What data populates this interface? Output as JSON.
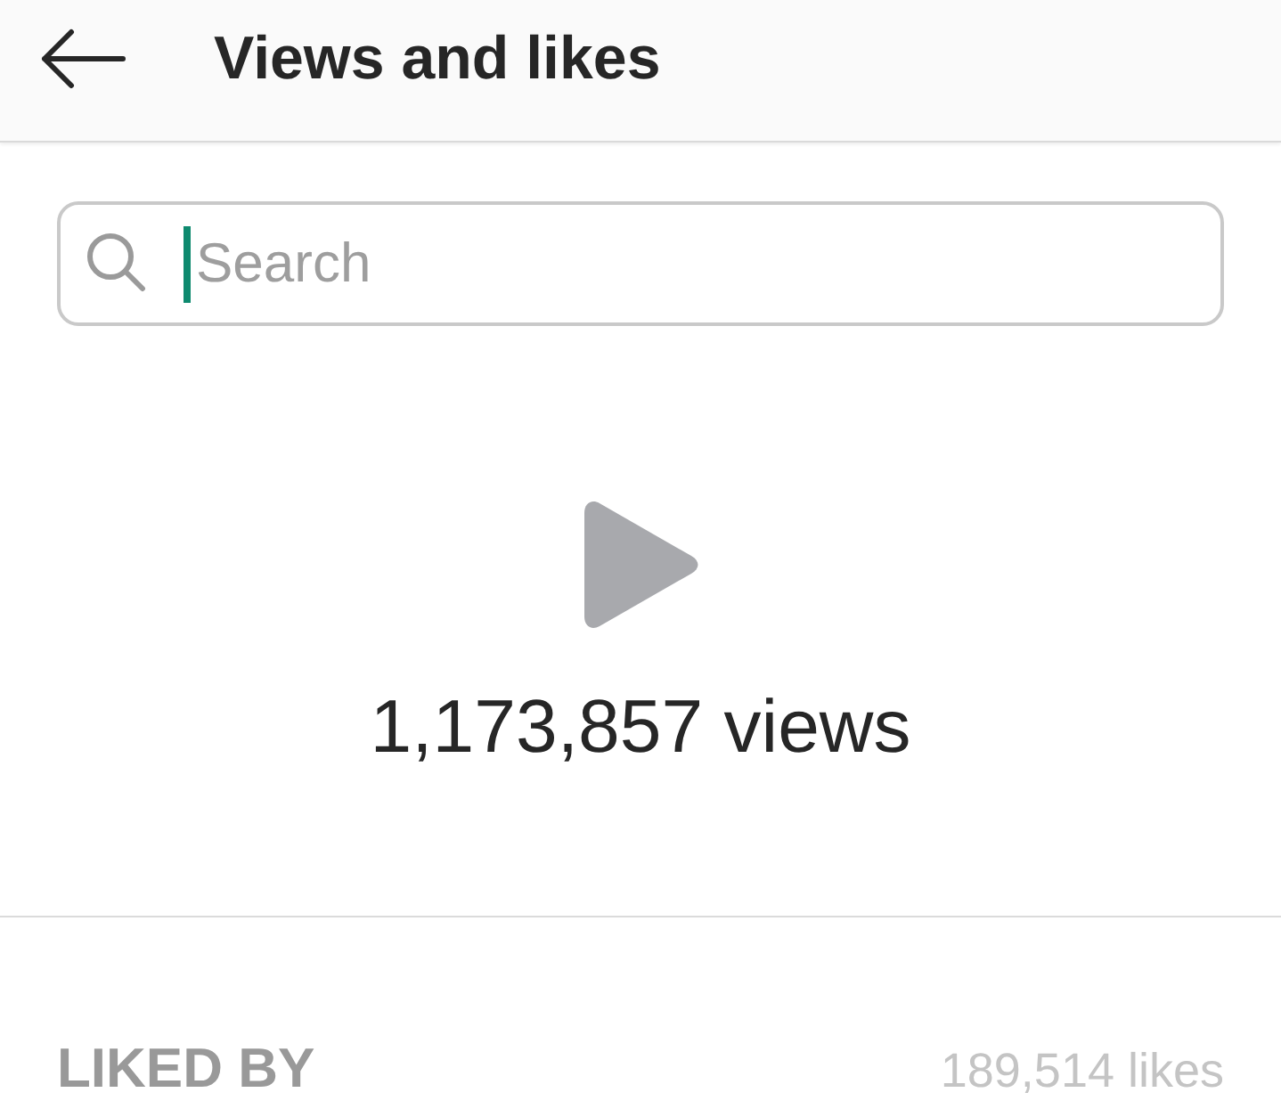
{
  "header": {
    "title": "Views and likes"
  },
  "search": {
    "placeholder": "Search",
    "focused": true
  },
  "views": {
    "count": "1,173,857 views"
  },
  "likes": {
    "heading": "LIKED BY",
    "count": "189,514 likes"
  }
}
